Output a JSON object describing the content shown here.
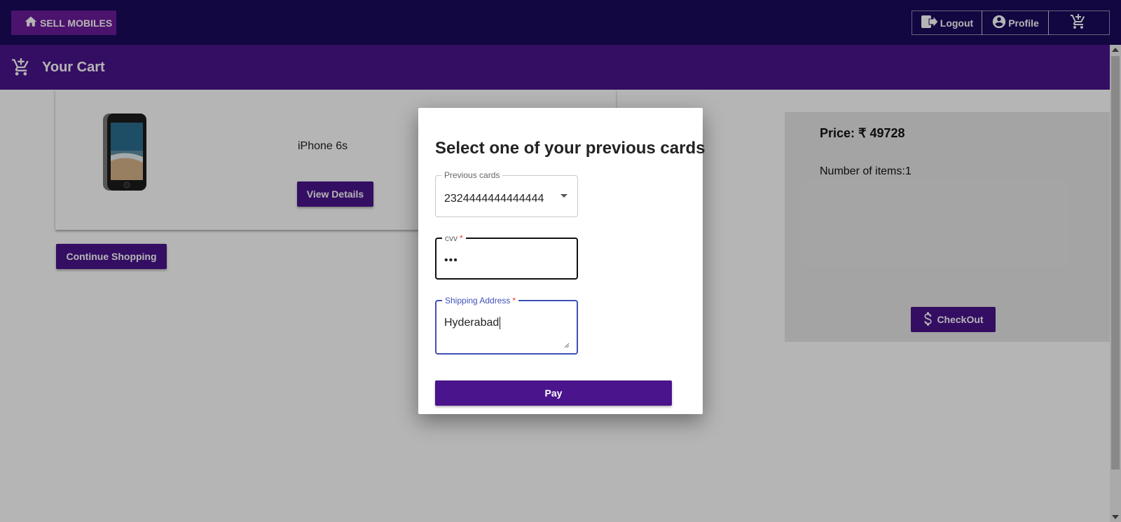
{
  "topnav": {
    "brand_label": "SELL MOBILES",
    "logout_label": "Logout",
    "profile_label": "Profile"
  },
  "subheader": {
    "title": "Your Cart"
  },
  "cart_item": {
    "name": "iPhone 6s",
    "view_details_label": "View Details"
  },
  "continue_shopping_label": "Continue Shopping",
  "summary": {
    "price": "Price: ₹ 49728",
    "items_count": "Number of items:1",
    "checkout_label": "CheckOut"
  },
  "modal": {
    "title": "Select one of your previous cards",
    "previous_cards_label": "Previous cards",
    "previous_cards_value": "2324444444444444",
    "cvv_label": "cvv",
    "cvv_value": "•••",
    "required_mark": "*",
    "address_label": "Shipping Address",
    "address_value": "Hyderabad",
    "pay_label": "Pay"
  },
  "colors": {
    "nav_bg": "#1a0a5c",
    "brand_btn": "#6a1b9a",
    "primary": "#4a148c",
    "focus": "#3f51b5"
  }
}
